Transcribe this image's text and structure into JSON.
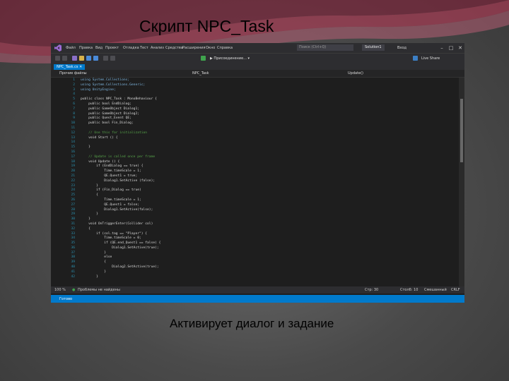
{
  "slide": {
    "title": "Скрипт NPC_Task",
    "caption": "Активирует диалог и задание"
  },
  "menubar": {
    "items": [
      "Файл",
      "Правка",
      "Вид",
      "Проект",
      "Отладка",
      "Тест",
      "Анализ",
      "Средства",
      "Расширения",
      "Окно",
      "Справка"
    ],
    "search_placeholder": "Поиск (Ctrl+Q)",
    "solution": "Solution1",
    "signin": "Вход"
  },
  "toolbar": {
    "attach_label": "▶ Присоединение... ▾",
    "live_share": "Live Share"
  },
  "tab": {
    "label": "NPC_Task.cs ✕"
  },
  "navbar": {
    "project": "Прочие файлы",
    "class": "NPC_Task",
    "method": "Update()"
  },
  "editor": {
    "lines": [
      {
        "n": "1",
        "text": "using System.Collections;",
        "kind": "kw"
      },
      {
        "n": "2",
        "text": "using System.Collections.Generic;",
        "kind": "kw"
      },
      {
        "n": "3",
        "text": "using UnityEngine;",
        "kind": "kw"
      },
      {
        "n": "4",
        "text": "",
        "kind": "plain"
      },
      {
        "n": "5",
        "text": "public class NPC_Task : MonoBehaviour {",
        "kind": "plain"
      },
      {
        "n": "6",
        "text": "    public bool EndDialog;",
        "kind": "plain"
      },
      {
        "n": "7",
        "text": "    public GameObject Dialog1;",
        "kind": "plain"
      },
      {
        "n": "8",
        "text": "    public GameObject Dialog2;",
        "kind": "plain"
      },
      {
        "n": "9",
        "text": "    public Quest_Event QE;",
        "kind": "plain"
      },
      {
        "n": "10",
        "text": "    public bool Fin_Dialog;",
        "kind": "plain"
      },
      {
        "n": "11",
        "text": "",
        "kind": "plain"
      },
      {
        "n": "12",
        "text": "    // Use this for initialization",
        "kind": "cm"
      },
      {
        "n": "13",
        "text": "    void Start () {",
        "kind": "plain"
      },
      {
        "n": "14",
        "text": "",
        "kind": "plain"
      },
      {
        "n": "15",
        "text": "    }",
        "kind": "plain"
      },
      {
        "n": "16",
        "text": "",
        "kind": "plain"
      },
      {
        "n": "17",
        "text": "    // Update is called once per frame",
        "kind": "cm"
      },
      {
        "n": "18",
        "text": "    void Update () {",
        "kind": "plain"
      },
      {
        "n": "19",
        "text": "        if (EndDialog == true) {",
        "kind": "plain"
      },
      {
        "n": "20",
        "text": "            Time.timeScale = 1;",
        "kind": "plain"
      },
      {
        "n": "21",
        "text": "            QE.Quest1 = true;",
        "kind": "plain"
      },
      {
        "n": "22",
        "text": "            Dialog1.SetActive (false);",
        "kind": "plain"
      },
      {
        "n": "23",
        "text": "        }",
        "kind": "plain"
      },
      {
        "n": "24",
        "text": "        if (Fin_Dialog == true)",
        "kind": "plain"
      },
      {
        "n": "25",
        "text": "        {",
        "kind": "plain"
      },
      {
        "n": "26",
        "text": "            Time.timeScale = 1;",
        "kind": "plain"
      },
      {
        "n": "27",
        "text": "            QE.Quest1 = false;",
        "kind": "plain"
      },
      {
        "n": "28",
        "text": "            Dialog1.SetActive(false);",
        "kind": "plain"
      },
      {
        "n": "29",
        "text": "        }",
        "kind": "plain"
      },
      {
        "n": "30",
        "text": "    }",
        "kind": "plain"
      },
      {
        "n": "31",
        "text": "    void OnTriggerEnter(Collider col)",
        "kind": "plain"
      },
      {
        "n": "32",
        "text": "    {",
        "kind": "plain"
      },
      {
        "n": "33",
        "text": "        if (col.tag == \"Player\") {",
        "kind": "plain"
      },
      {
        "n": "34",
        "text": "            Time.timeScale = 0;",
        "kind": "plain"
      },
      {
        "n": "35",
        "text": "            if (QE.end_Quest1 == false) {",
        "kind": "plain"
      },
      {
        "n": "36",
        "text": "                Dialog1.SetActive(true);",
        "kind": "plain"
      },
      {
        "n": "37",
        "text": "            }",
        "kind": "plain"
      },
      {
        "n": "38",
        "text": "            else",
        "kind": "plain"
      },
      {
        "n": "39",
        "text": "            {",
        "kind": "plain"
      },
      {
        "n": "40",
        "text": "                Dialog2.SetActive(true);",
        "kind": "plain"
      },
      {
        "n": "41",
        "text": "            }",
        "kind": "plain"
      },
      {
        "n": "42",
        "text": "        }",
        "kind": "plain"
      }
    ]
  },
  "statusline": {
    "zoom": "100 %",
    "issues": "Проблемы не найдены",
    "row": "Стр: 30",
    "col": "Столб: 10",
    "mode": "Смешанный",
    "eol": "CRLF"
  },
  "statusbar": {
    "text": "Готово"
  },
  "colors": {
    "accent": "#007acc",
    "editor_bg": "#1e1e1e",
    "chrome": "#2d2d30"
  }
}
